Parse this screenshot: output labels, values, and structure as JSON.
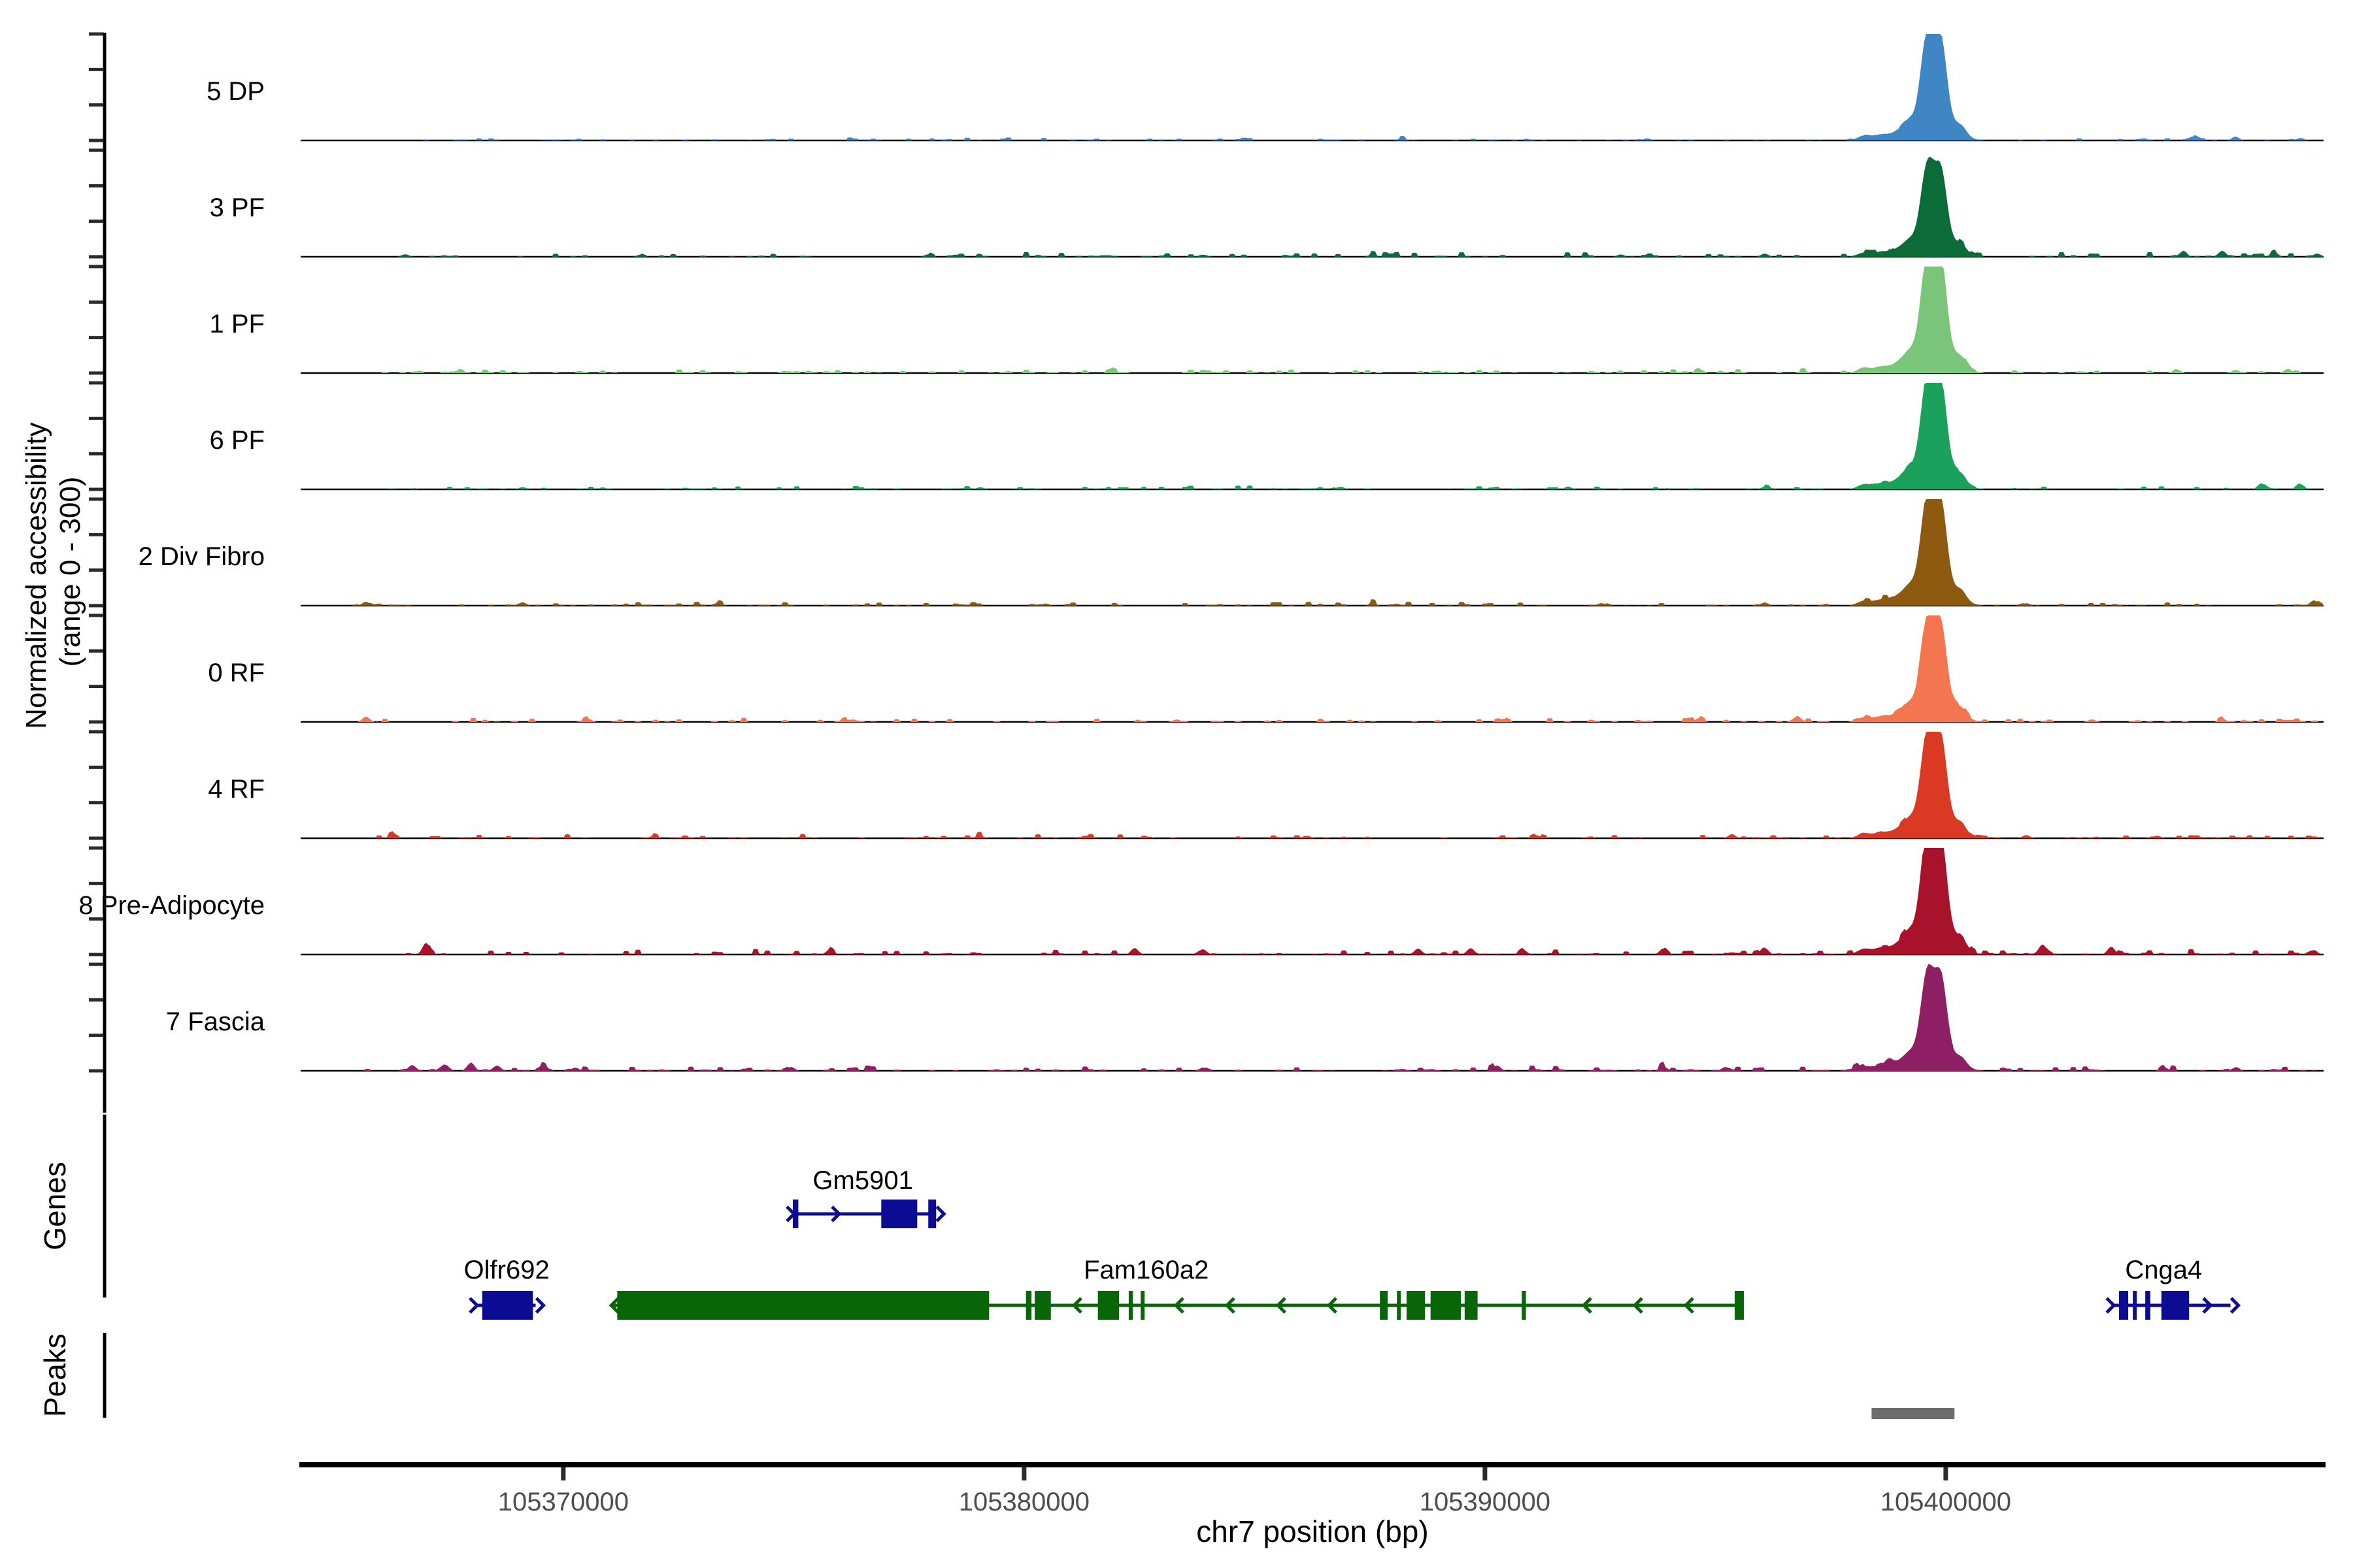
{
  "labels": {
    "y_axis_line1": "Normalized accessibility",
    "y_axis_line2": "(range 0 - 300)",
    "x_title": "chr7 position (bp)",
    "genes_section": "Genes",
    "peaks_section": "Peaks"
  },
  "chart_data": {
    "type": "area",
    "description": "Single-cell ATAC-seq normalized accessibility coverage tracks for 9 cell clusters over chr7, with gene models and a called peak",
    "xlabel": "chr7 position (bp)",
    "ylabel": "Normalized accessibility (range 0 - 300)",
    "x_range_bp": [
      105364300,
      105408200
    ],
    "y_range_per_track": [
      0,
      300
    ],
    "grid": false,
    "x_ticks": [
      {
        "bp": 105370000,
        "label": "105370000"
      },
      {
        "bp": 105380000,
        "label": "105380000"
      },
      {
        "bp": 105390000,
        "label": "105390000"
      },
      {
        "bp": 105400000,
        "label": "105400000"
      }
    ],
    "main_peak": {
      "summit_bp": 105399600,
      "secondary_summit_bp": 105399900,
      "span_bp": [
        105398900,
        105400450
      ]
    },
    "tracks": [
      {
        "label": "5 DP",
        "color": "#3e87c4",
        "peak_value": 240,
        "noise_factor": 0.7,
        "noise_bumps": [
          [
            105388200,
            7
          ],
          [
            105393520,
            6
          ],
          [
            105405360,
            9
          ],
          [
            105406290,
            11
          ],
          [
            105407700,
            7
          ]
        ]
      },
      {
        "label": "3 PF",
        "color": "#0c6c38",
        "peak_value": 206,
        "noise_factor": 1.1,
        "noise_bumps": [
          [
            105366570,
            7
          ],
          [
            105371680,
            6
          ],
          [
            105377920,
            7
          ],
          [
            105383880,
            6
          ],
          [
            105387560,
            7
          ],
          [
            105392950,
            6
          ],
          [
            105396070,
            9
          ],
          [
            105405150,
            15
          ],
          [
            105406000,
            17
          ],
          [
            105407130,
            13
          ],
          [
            105408060,
            9
          ]
        ]
      },
      {
        "label": "1 PF",
        "color": "#79c579",
        "peak_value": 265,
        "noise_factor": 0.9,
        "noise_bumps": [
          [
            105367700,
            7
          ],
          [
            105374800,
            6
          ],
          [
            105381890,
            6
          ],
          [
            105388980,
            7
          ],
          [
            105394650,
            9
          ],
          [
            105396920,
            7
          ],
          [
            105405010,
            11
          ],
          [
            105406290,
            9
          ],
          [
            105407420,
            11
          ]
        ]
      },
      {
        "label": "6 PF",
        "color": "#1aa15c",
        "peak_value": 254,
        "noise_factor": 0.9,
        "noise_bumps": [
          [
            105369120,
            6
          ],
          [
            105379050,
            6
          ],
          [
            105386850,
            7
          ],
          [
            105391820,
            6
          ],
          [
            105396070,
            7
          ],
          [
            105406850,
            17
          ],
          [
            105407700,
            15
          ]
        ]
      },
      {
        "label": "2 Div Fibro",
        "color": "#8d5a0f",
        "peak_value": 247,
        "noise_factor": 1.0,
        "noise_bumps": [
          [
            105365720,
            11
          ],
          [
            105369120,
            9
          ],
          [
            105373380,
            7
          ],
          [
            105380470,
            6
          ],
          [
            105387560,
            7
          ],
          [
            105392530,
            7
          ],
          [
            105396070,
            9
          ],
          [
            105401750,
            7
          ],
          [
            105407990,
            15
          ]
        ]
      },
      {
        "label": "0 RF",
        "color": "#f3764f",
        "peak_value": 230,
        "noise_factor": 1.0,
        "noise_bumps": [
          [
            105365720,
            15
          ],
          [
            105370540,
            9
          ],
          [
            105376210,
            7
          ],
          [
            105383310,
            7
          ],
          [
            105390400,
            9
          ],
          [
            105394650,
            11
          ],
          [
            105396780,
            15
          ],
          [
            105403170,
            7
          ],
          [
            105406000,
            9
          ]
        ]
      },
      {
        "label": "4 RF",
        "color": "#da3a24",
        "peak_value": 240,
        "noise_factor": 1.0,
        "noise_bumps": [
          [
            105366290,
            11
          ],
          [
            105371960,
            7
          ],
          [
            105379050,
            7
          ],
          [
            105386140,
            7
          ],
          [
            105391110,
            9
          ],
          [
            105395360,
            11
          ],
          [
            105401750,
            9
          ],
          [
            105404590,
            7
          ]
        ]
      },
      {
        "label": "8 Pre-Adipocyte",
        "color": "#a8122b",
        "peak_value": 282,
        "noise_factor": 1.3,
        "noise_bumps": [
          [
            105367020,
            33
          ],
          [
            105375790,
            15
          ],
          [
            105382400,
            18
          ],
          [
            105383880,
            15
          ],
          [
            105388550,
            17
          ],
          [
            105389690,
            18
          ],
          [
            105390820,
            15
          ],
          [
            105393870,
            17
          ],
          [
            105396070,
            18
          ],
          [
            105402100,
            26
          ],
          [
            105403590,
            22
          ],
          [
            105407990,
            11
          ]
        ]
      },
      {
        "label": "7 Fascia",
        "color": "#8e1f64",
        "peak_value": 222,
        "noise_factor": 1.3,
        "noise_bumps": [
          [
            105366710,
            15
          ],
          [
            105367420,
            18
          ],
          [
            105367990,
            22
          ],
          [
            105368560,
            15
          ],
          [
            105369550,
            11
          ],
          [
            105370260,
            9
          ],
          [
            105374940,
            11
          ],
          [
            105383880,
            9
          ],
          [
            105390260,
            15
          ],
          [
            105393870,
            13
          ],
          [
            105395220,
            11
          ],
          [
            105398770,
            18
          ],
          [
            105404730,
            11
          ],
          [
            105406290,
            9
          ]
        ]
      }
    ],
    "genes": [
      {
        "name": "Gm5901",
        "row": 0,
        "strand": "+",
        "color": "#0b0b94",
        "start_bp": 105374980,
        "end_bp": 105378090,
        "label_bp": 105376500,
        "arrow_spacing_px": 65,
        "exons_bp": [
          [
            105374980,
            105375100
          ],
          [
            105376900,
            105377680
          ],
          [
            105377920,
            105378090
          ]
        ]
      },
      {
        "name": "Olfr692",
        "row": 1,
        "strand": "+",
        "color": "#0b0b94",
        "start_bp": 105368100,
        "end_bp": 105369400,
        "label_bp": 105368770,
        "arrow_spacing_px": 160,
        "exons_bp": [
          [
            105368240,
            105369340
          ]
        ]
      },
      {
        "name": "Fam160a2",
        "row": 1,
        "strand": "-",
        "color": "#086608",
        "start_bp": 105371040,
        "end_bp": 105395620,
        "label_bp": 105382650,
        "arrow_spacing_px": 78,
        "exons_bp": [
          [
            105371170,
            105379240
          ],
          [
            105380040,
            105380160
          ],
          [
            105380230,
            105380580
          ],
          [
            105381600,
            105382060
          ],
          [
            105382270,
            105382360
          ],
          [
            105382530,
            105382600
          ],
          [
            105387720,
            105387890
          ],
          [
            105388090,
            105388160
          ],
          [
            105388300,
            105388700
          ],
          [
            105388820,
            105389480
          ],
          [
            105389560,
            105389840
          ],
          [
            105390800,
            105390890
          ],
          [
            105395420,
            105395620
          ]
        ]
      },
      {
        "name": "Cnga4",
        "row": 1,
        "strand": "+",
        "color": "#0b0b94",
        "start_bp": 105403620,
        "end_bp": 105406180,
        "label_bp": 105404730,
        "arrow_spacing_px": 48,
        "exons_bp": [
          [
            105403760,
            105403960
          ],
          [
            105404060,
            105404140
          ],
          [
            105404330,
            105404440
          ],
          [
            105404680,
            105405280
          ]
        ]
      }
    ],
    "peaks": {
      "color": "#6d6d6d",
      "intervals_bp": [
        [
          105398390,
          105400190
        ]
      ]
    }
  }
}
